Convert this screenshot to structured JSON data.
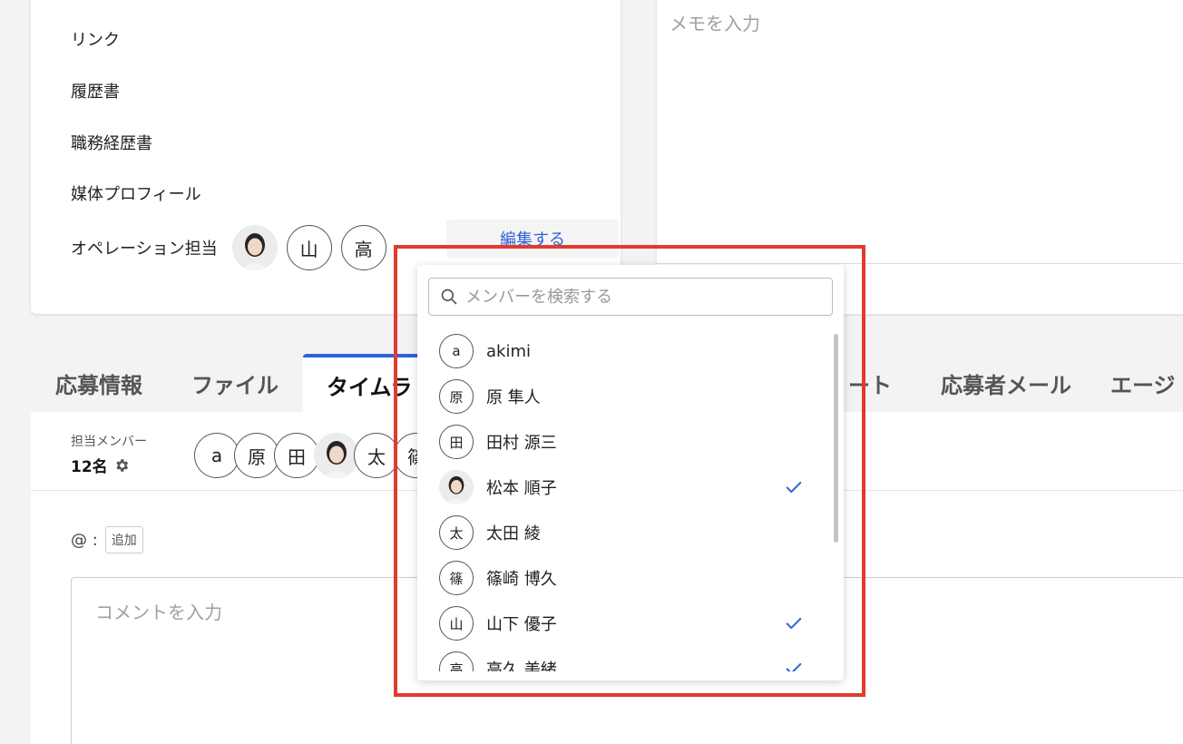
{
  "top_fields": {
    "link": "リンク",
    "resume": "履歴書",
    "work_history": "職務経歴書",
    "media_profile": "媒体プロフィール",
    "operation": "オペレーション担当",
    "op_avatar_1": "山",
    "op_avatar_2": "高",
    "edit": "編集する"
  },
  "memo": {
    "placeholder": "メモを入力"
  },
  "tabs": [
    {
      "label": "応募情報"
    },
    {
      "label": "ファイル"
    },
    {
      "label": "タイムラ"
    },
    {
      "label": "ート"
    },
    {
      "label": "応募者メール"
    },
    {
      "label": "エージ"
    }
  ],
  "members": {
    "label": "担当メンバー",
    "count": "12名",
    "strip": [
      "a",
      "原",
      "田",
      "太",
      "篠"
    ]
  },
  "mention": {
    "at": "@ :",
    "add": "追加"
  },
  "comment": {
    "placeholder": "コメントを入力"
  },
  "dropdown": {
    "search_placeholder": "メンバーを検索する",
    "items": [
      {
        "initial": "a",
        "name": "akimi",
        "checked": false
      },
      {
        "initial": "原",
        "name": "原 隼人",
        "checked": false
      },
      {
        "initial": "田",
        "name": "田村 源三",
        "checked": false
      },
      {
        "initial": "",
        "name": "松本 順子",
        "checked": true
      },
      {
        "initial": "太",
        "name": "太田 綾",
        "checked": false
      },
      {
        "initial": "篠",
        "name": "篠崎 博久",
        "checked": false
      },
      {
        "initial": "山",
        "name": "山下 優子",
        "checked": true
      },
      {
        "initial": "高",
        "name": "高久 美緒",
        "checked": true
      }
    ]
  },
  "colors": {
    "accent": "#2e63d6",
    "highlight": "#e23a2f"
  }
}
